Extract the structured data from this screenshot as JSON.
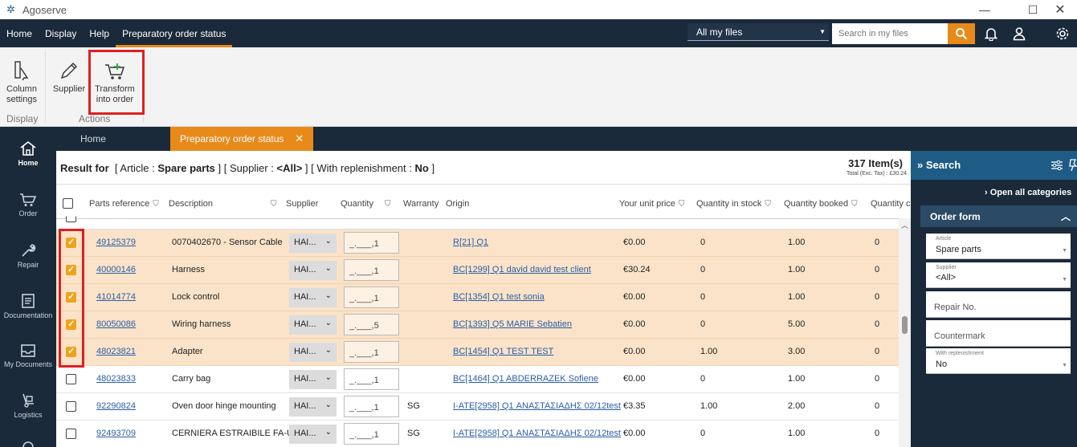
{
  "app": {
    "title": "Agoserve",
    "logo_icon": "gear-flower-icon"
  },
  "menu": {
    "items": [
      "Home",
      "Display",
      "Help",
      "Preparatory order status"
    ],
    "file_select": "All my files",
    "search_placeholder": "Search in my files"
  },
  "ribbon": {
    "column_settings": "Column settings",
    "supplier": "Supplier",
    "transform": "Transform into order",
    "group_display": "Display",
    "group_actions": "Actions"
  },
  "nav": {
    "home": "Home",
    "order": "Order",
    "repair": "Repair",
    "documentation": "Documentation",
    "my_documents": "My Documents",
    "logistics": "Logistics"
  },
  "tabs": {
    "home": "Home",
    "active": "Preparatory order status"
  },
  "result": {
    "label": "Result for",
    "article_label": "[ Article : ",
    "article_value": "Spare parts",
    "supplier_label": " ]   [ Supplier : ",
    "supplier_value": "<All>",
    "repl_label": " ]   [ With replenishment : ",
    "repl_value": "No",
    "repl_end": " ]",
    "count": "317 Item(s)",
    "total_tax": "Total (Exc. Tax) : £30.24"
  },
  "columns": {
    "parts_ref": "Parts reference",
    "description": "Description",
    "supplier": "Supplier",
    "quantity": "Quantity",
    "warranty": "Warranty",
    "origin": "Origin",
    "unit_price": "Your unit price",
    "qty_stock": "Quantity in stock",
    "qty_booked": "Quantity booked",
    "qty_c": "Quantity c"
  },
  "rows": [
    {
      "ref": "49125379",
      "desc": "0070402670 - Sensor Cable",
      "supplier": "HAI...",
      "qty": "_.___,1",
      "warranty": "",
      "origin": "R[21] Q1 ",
      "price": "€0.00",
      "stock": "0",
      "booked": "1.00",
      "qc": "0"
    },
    {
      "ref": "40000146",
      "desc": "Harness",
      "supplier": "HAI...",
      "qty": "_.___,1",
      "warranty": "",
      "origin": "BC[1299] Q1 david david test client",
      "price": "€30.24",
      "stock": "0",
      "booked": "1.00",
      "qc": "0"
    },
    {
      "ref": "41014774",
      "desc": "Lock control",
      "supplier": "HAI...",
      "qty": "_.___,1",
      "warranty": "",
      "origin": "BC[1354] Q1 test sonia ",
      "price": "€0.00",
      "stock": "0",
      "booked": "1.00",
      "qc": "0"
    },
    {
      "ref": "80050086",
      "desc": "Wiring harness",
      "supplier": "HAI...",
      "qty": "_.___,5",
      "warranty": "",
      "origin": "BC[1393] Q5 MARIE Sebatien",
      "price": "€0.00",
      "stock": "0",
      "booked": "5.00",
      "qc": "0"
    },
    {
      "ref": "48023821",
      "desc": "Adapter",
      "supplier": "HAI...",
      "qty": "_.___,1",
      "warranty": "",
      "origin": "BC[1454] Q1 TEST TEST",
      "price": "€0.00",
      "stock": "1.00",
      "booked": "3.00",
      "qc": "0"
    },
    {
      "ref": "48023833",
      "desc": "Carry bag",
      "supplier": "HAI...",
      "qty": "_.___,1",
      "warranty": "",
      "origin": "BC[1464] Q1 ABDERRAZEK Sofiene",
      "price": "€0.00",
      "stock": "0",
      "booked": "1.00",
      "qc": "0"
    },
    {
      "ref": "92290824",
      "desc": "Oven door hinge mounting",
      "supplier": "HAI...",
      "qty": "_.___,1",
      "warranty": "SG",
      "origin": "I-ATE[2958] Q1 ΑΝΑΣΤΑΣΙΑΔΗΣ 02/12test",
      "price": "€3.35",
      "stock": "1.00",
      "booked": "2.00",
      "qc": "0"
    },
    {
      "ref": "92493709",
      "desc": "CERNIERA ESTRAIBILE FA-UA",
      "supplier": "HAI...",
      "qty": "_.___,1",
      "warranty": "SG",
      "origin": "I-ATE[2958] Q1 ΑΝΑΣΤΑΣΙΑΔΗΣ 02/12test",
      "price": "€0.00",
      "stock": "0",
      "booked": "1.00",
      "qc": "0"
    }
  ],
  "search_panel": {
    "title": "Search",
    "open_all": "Open all categories",
    "order_form": "Order form",
    "article_label": "Article",
    "article_value": "Spare parts",
    "supplier_label": "Supplier",
    "supplier_value": "<All>",
    "repair_no": "Repair No.",
    "countermark": "Countermark",
    "repl_label": "With replenishment",
    "repl_value": "No"
  },
  "colors": {
    "accent": "#e88a1a",
    "navy": "#1b2a3a",
    "selected_row": "#fae3c8",
    "highlight": "#e01f1f"
  }
}
